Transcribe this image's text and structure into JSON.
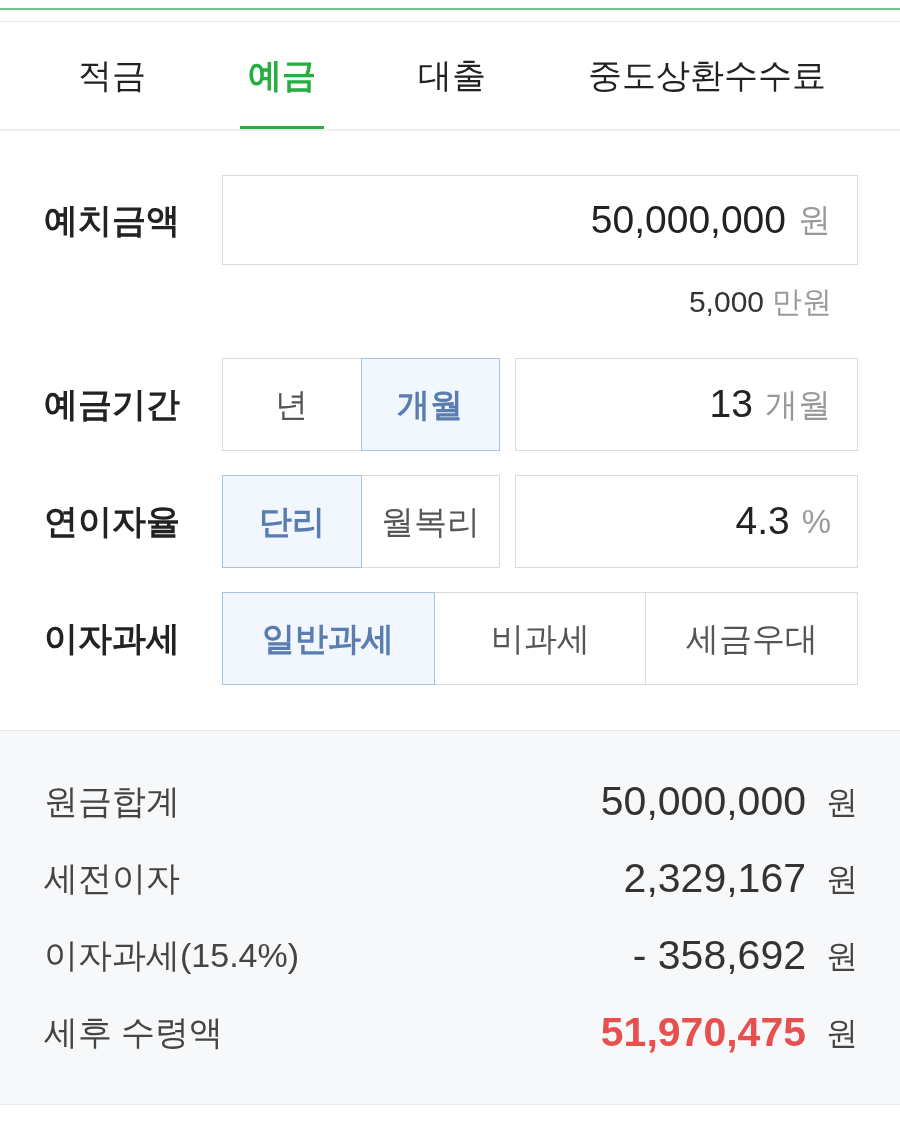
{
  "tabs": [
    {
      "label": "적금",
      "selected": false
    },
    {
      "label": "예금",
      "selected": true
    },
    {
      "label": "대출",
      "selected": false
    },
    {
      "label": "중도상환수수료",
      "selected": false
    }
  ],
  "fields": [
    {
      "kind": "amount",
      "label": "예치금액",
      "value": "50,000,000",
      "unit": "원",
      "converted": {
        "value": "5,000",
        "unit": "만원"
      }
    },
    {
      "kind": "choice_input",
      "label": "예금기간",
      "options": [
        {
          "label": "년",
          "selected": false
        },
        {
          "label": "개월",
          "selected": true
        }
      ],
      "value": "13",
      "unit": "개월"
    },
    {
      "kind": "choice_input",
      "label": "연이자율",
      "options": [
        {
          "label": "단리",
          "selected": true
        },
        {
          "label": "월복리",
          "selected": false
        }
      ],
      "value": "4.3",
      "unit": "%"
    },
    {
      "kind": "choice",
      "label": "이자과세",
      "options": [
        {
          "label": "일반과세",
          "selected": true
        },
        {
          "label": "비과세",
          "selected": false
        },
        {
          "label": "세금우대",
          "selected": false
        }
      ]
    }
  ],
  "results": [
    {
      "label": "원금합계",
      "value": "50,000,000",
      "unit": "원",
      "emphasized": false
    },
    {
      "label": "세전이자",
      "value": "2,329,167",
      "unit": "원",
      "emphasized": false
    },
    {
      "label": "이자과세(15.4%)",
      "value": "- 358,692",
      "unit": "원",
      "emphasized": false
    },
    {
      "label": "세후 수령액",
      "value": "51,970,475",
      "unit": "원",
      "emphasized": true
    }
  ]
}
